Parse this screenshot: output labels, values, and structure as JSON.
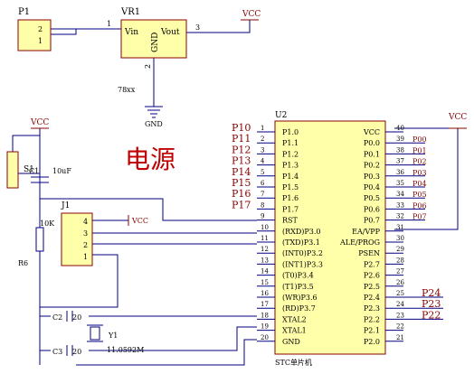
{
  "title": "电源",
  "colors": {
    "wire": "#000080",
    "part_fill": "#ffffaa",
    "part_stroke": "#8b0000",
    "text": "#000000",
    "label": "#8b0000",
    "title": "#c00000",
    "vcc": "#8b0000"
  },
  "p1": {
    "ref": "P1",
    "pins": [
      "2",
      "1"
    ]
  },
  "vr1": {
    "ref": "VR1",
    "vin": "Vin",
    "vout": "Vout",
    "gnd": "GND",
    "pin1": "1",
    "pin2": "2",
    "pin3": "3",
    "part": "78xx"
  },
  "vcc": "VCC",
  "gnd": "GND",
  "u2": {
    "ref": "U2",
    "name": "STC单片机",
    "left_pins": [
      {
        "num": "1",
        "label": "P1.0",
        "net": "P10"
      },
      {
        "num": "2",
        "label": "P1.1",
        "net": "P11"
      },
      {
        "num": "3",
        "label": "P1.2",
        "net": "P12"
      },
      {
        "num": "4",
        "label": "P1.3",
        "net": "P13"
      },
      {
        "num": "5",
        "label": "P1.4",
        "net": "P14"
      },
      {
        "num": "6",
        "label": "P1.5",
        "net": "P15"
      },
      {
        "num": "7",
        "label": "P1.6",
        "net": "P16"
      },
      {
        "num": "8",
        "label": "P1.7",
        "net": "P17"
      },
      {
        "num": "9",
        "label": "RST",
        "net": ""
      },
      {
        "num": "10",
        "label": "(RXD)P3.0",
        "net": ""
      },
      {
        "num": "11",
        "label": "(TXD)P3.1",
        "net": ""
      },
      {
        "num": "12",
        "label": "(INT0)P3.2",
        "net": ""
      },
      {
        "num": "13",
        "label": "(INT1)P3.3",
        "net": ""
      },
      {
        "num": "14",
        "label": "(T0)P3.4",
        "net": ""
      },
      {
        "num": "15",
        "label": "(T1)P3.5",
        "net": ""
      },
      {
        "num": "16",
        "label": "(WR)P3.6",
        "net": ""
      },
      {
        "num": "17",
        "label": "(RD)P3.7",
        "net": ""
      },
      {
        "num": "18",
        "label": "XTAL2",
        "net": ""
      },
      {
        "num": "19",
        "label": "XTAL1",
        "net": ""
      },
      {
        "num": "20",
        "label": "GND",
        "net": ""
      }
    ],
    "right_pins": [
      {
        "num": "40",
        "label": "VCC",
        "net": ""
      },
      {
        "num": "39",
        "label": "P0.0",
        "net": "P00"
      },
      {
        "num": "38",
        "label": "P0.1",
        "net": "P01"
      },
      {
        "num": "37",
        "label": "P0.2",
        "net": "P02"
      },
      {
        "num": "36",
        "label": "P0.3",
        "net": "P03"
      },
      {
        "num": "35",
        "label": "P0.4",
        "net": "P04"
      },
      {
        "num": "34",
        "label": "P0.5",
        "net": "P05"
      },
      {
        "num": "33",
        "label": "P0.6",
        "net": "P06"
      },
      {
        "num": "32",
        "label": "P0.7",
        "net": "P07"
      },
      {
        "num": "31",
        "label": "EA/VPP",
        "net": ""
      },
      {
        "num": "30",
        "label": "ALE/PROG",
        "net": ""
      },
      {
        "num": "29",
        "label": "PSEN",
        "net": ""
      },
      {
        "num": "28",
        "label": "P2.7",
        "net": ""
      },
      {
        "num": "27",
        "label": "P2.6",
        "net": ""
      },
      {
        "num": "26",
        "label": "P2.5",
        "net": ""
      },
      {
        "num": "25",
        "label": "P2.4",
        "net": "P24"
      },
      {
        "num": "24",
        "label": "P2.3",
        "net": "P23"
      },
      {
        "num": "23",
        "label": "P2.2",
        "net": "P22"
      },
      {
        "num": "22",
        "label": "P2.1",
        "net": ""
      },
      {
        "num": "21",
        "label": "P2.0",
        "net": ""
      }
    ]
  },
  "s1": {
    "ref": "S1"
  },
  "c1": {
    "ref": "C1",
    "value": "10uF"
  },
  "j1": {
    "ref": "J1",
    "pins": [
      "4",
      "3",
      "2",
      "1"
    ]
  },
  "r6": {
    "ref": "R6",
    "value": "10K"
  },
  "c2": {
    "ref": "C2",
    "value": "20"
  },
  "c3": {
    "ref": "C3",
    "value": "20"
  },
  "y1": {
    "ref": "Y1",
    "value": "11.0592M"
  }
}
